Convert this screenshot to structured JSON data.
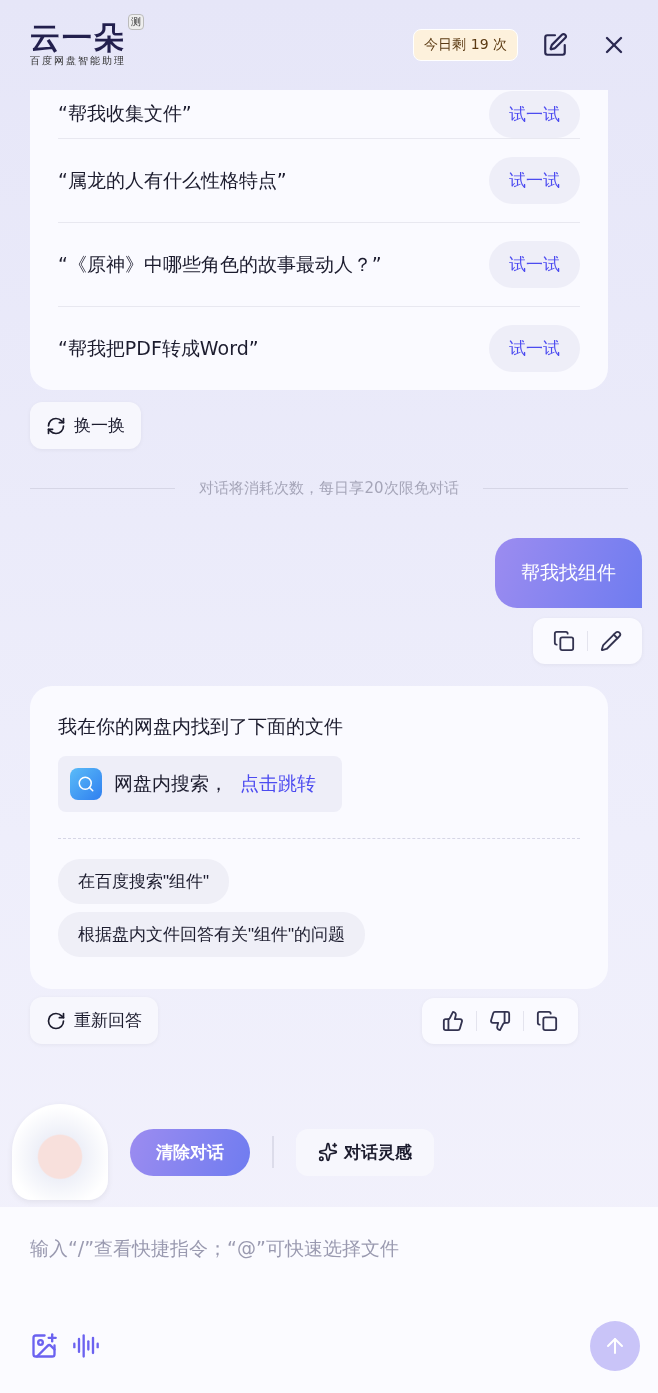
{
  "header": {
    "logo": "云一朵",
    "logo_badge": "测",
    "subtitle": "百度网盘智能助理",
    "quota": "今日剩 19 次"
  },
  "suggestions": [
    {
      "text": "“帮我收集文件”",
      "action": "试一试"
    },
    {
      "text": "“属龙的人有什么性格特点”",
      "action": "试一试"
    },
    {
      "text": "“《原神》中哪些角色的故事最动人？”",
      "action": "试一试"
    },
    {
      "text": "“帮我把PDF转成Word”",
      "action": "试一试"
    }
  ],
  "refresh_button": "换一换",
  "notice": "对话将消耗次数，每日享20次限免对话",
  "user_message": "帮我找组件",
  "answer": {
    "text": "我在你的网盘内找到了下面的文件",
    "search_label": "网盘内搜索，",
    "search_link": "点击跳转",
    "followups": [
      "在百度搜索\"组件\"",
      "根据盘内文件回答有关\"组件\"的问题"
    ]
  },
  "regenerate_button": "重新回答",
  "clear_button": "清除对话",
  "inspiration_button": "对话灵感",
  "input": {
    "placeholder": "输入“/”查看快捷指令；“@”可快速选择文件"
  }
}
